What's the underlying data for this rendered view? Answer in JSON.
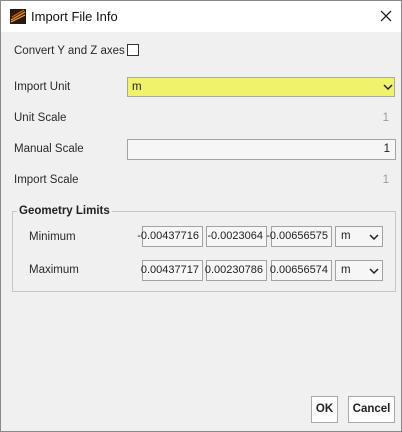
{
  "window": {
    "title": "Import File Info"
  },
  "icons": {
    "app": "import-app-icon",
    "close": "close-icon",
    "dropdown": "chevron-down-icon"
  },
  "colors": {
    "highlight": "#f0f26a"
  },
  "form": {
    "convert_axes_label": "Convert Y and Z axes",
    "convert_axes_checked": false,
    "import_unit_label": "Import Unit",
    "import_unit_value": "m",
    "unit_scale_label": "Unit Scale",
    "unit_scale_value": "1",
    "manual_scale_label": "Manual Scale",
    "manual_scale_value": "1",
    "import_scale_label": "Import Scale",
    "import_scale_value": "1"
  },
  "geometry_limits": {
    "title": "Geometry Limits",
    "minimum": {
      "label": "Minimum",
      "x": "-0.00437716",
      "y": "-0.0023064",
      "z": "-0.00656575",
      "unit": "m"
    },
    "maximum": {
      "label": "Maximum",
      "x": "0.00437717",
      "y": "0.00230786",
      "z": "0.00656574",
      "unit": "m"
    }
  },
  "buttons": {
    "ok": "OK",
    "cancel": "Cancel"
  }
}
